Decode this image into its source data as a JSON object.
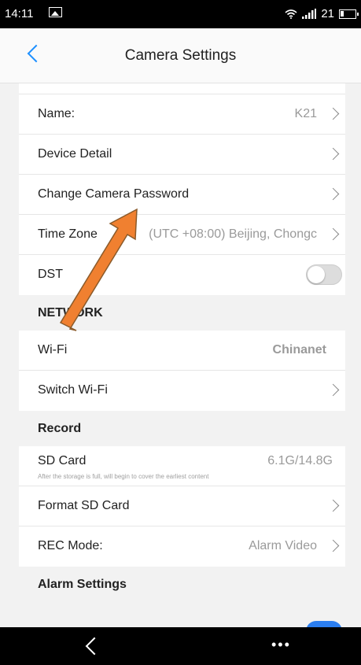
{
  "status_bar": {
    "time": "14:11",
    "battery": "21"
  },
  "header": {
    "title": "Camera Settings"
  },
  "rows_top": [
    {
      "label": "Name:",
      "value": "K21"
    },
    {
      "label": "Device Detail",
      "value": ""
    },
    {
      "label": "Change Camera Password",
      "value": ""
    },
    {
      "label": "Time Zone",
      "value": "(UTC +08:00) Beijing, Chongc"
    },
    {
      "label": "DST"
    }
  ],
  "network": {
    "section_label": "NETWORK",
    "wifi_label": "Wi-Fi",
    "wifi_value": "Chinanet",
    "switch_label": "Switch Wi-Fi"
  },
  "record": {
    "section_label": "Record",
    "sd_label": "SD Card",
    "sd_value": "6.1G/14.8G",
    "sd_note": "After the storage is full, will begin to cover the earliest content",
    "format_label": "Format SD Card",
    "rec_label": "REC Mode:",
    "rec_value": "Alarm Video"
  },
  "alarm": {
    "section_label": "Alarm Settings"
  },
  "nav": {
    "more": "•••"
  },
  "colors": {
    "accent": "#1e90ff",
    "arrow": "#f08030"
  }
}
